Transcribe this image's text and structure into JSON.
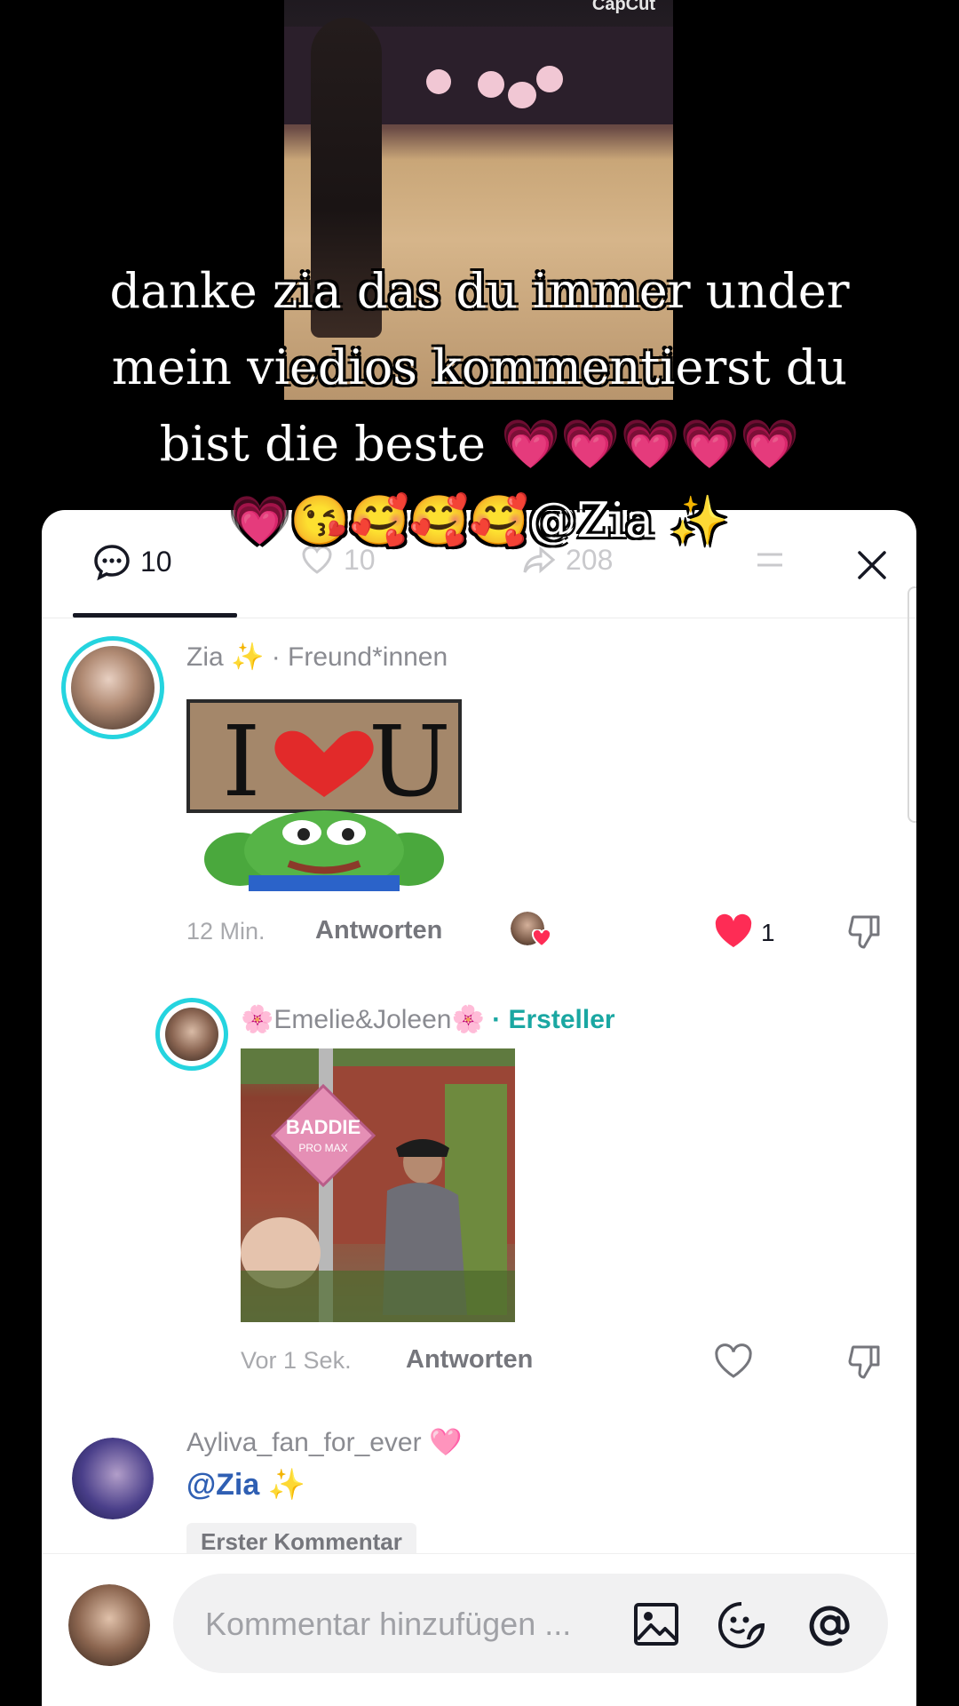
{
  "video": {
    "watermark": "CapCut",
    "caption_line1": "danke zia das du immer under",
    "caption_line2": "mein viedios kommentierst du",
    "caption_line3": "bist die beste 💗💗💗💗💗",
    "caption_line4": "💗😘🥰🥰🥰@Zia ✨"
  },
  "tabs": {
    "comments_count": "10",
    "likes_count": "10",
    "shares_count": "208"
  },
  "comments": [
    {
      "author": "Zia ✨",
      "relation": "· Freund*innen",
      "sticker_text_left": "I",
      "sticker_text_right": "U",
      "time": "12 Min.",
      "reply_label": "Antworten",
      "like_count": "1"
    },
    {
      "author": "🌸Emelie&Joleen🌸",
      "relation": "· Ersteller",
      "gif_sign_line1": "BADDIE",
      "gif_sign_line2": "PRO MAX",
      "time": "Vor 1 Sek.",
      "reply_label": "Antworten"
    },
    {
      "author": "Ayliva_fan_for_ever 🩷",
      "mention": "@Zia ✨",
      "badge": "Erster Kommentar"
    }
  ],
  "input": {
    "placeholder": "Kommentar hinzufügen ..."
  },
  "colors": {
    "accent_teal": "#25d4df",
    "like_red": "#fe2c55",
    "mention_blue": "#2f5fb3"
  }
}
